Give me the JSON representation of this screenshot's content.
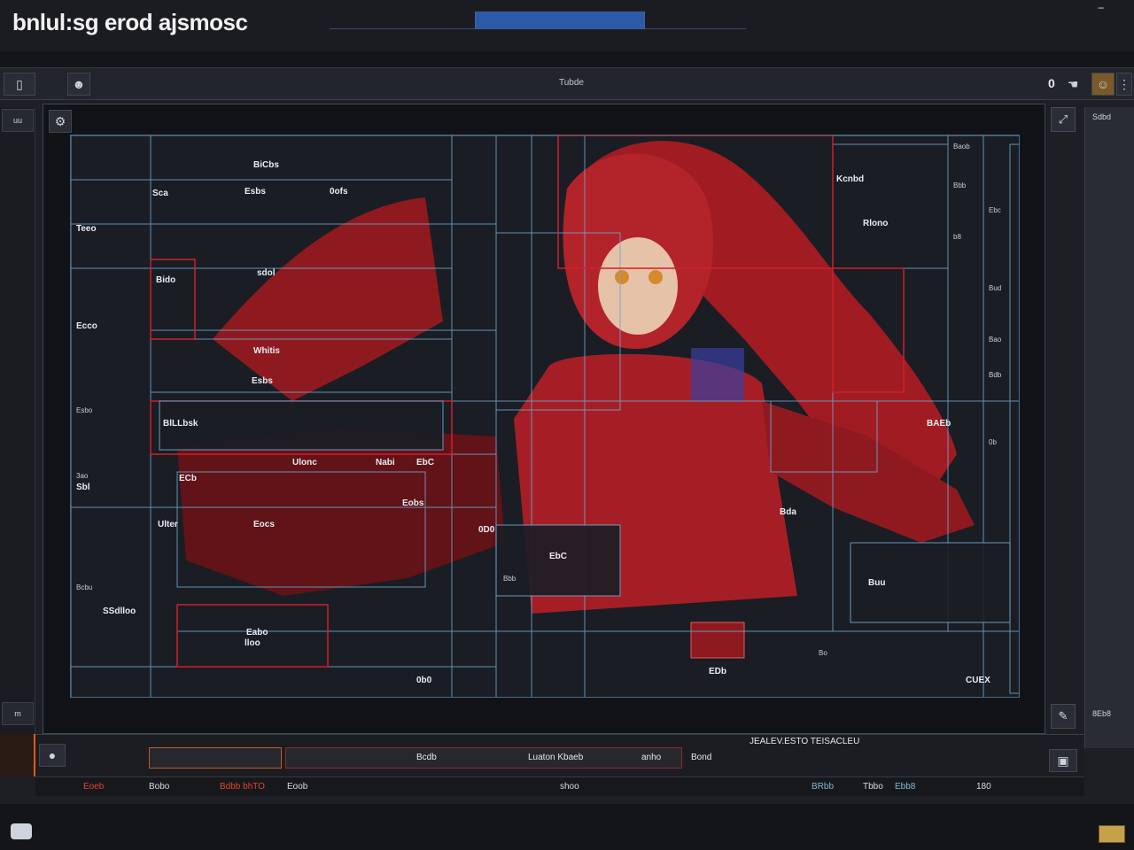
{
  "app": {
    "title": "bnlul:sg erod ajsmosc",
    "menu_glyph": "‾",
    "progress": 1.0
  },
  "toolbar": {
    "center_label": "Tubde",
    "right_count": "0"
  },
  "left_rail": {
    "tabs": [
      "uu",
      "m"
    ]
  },
  "right_panel": {
    "labels": [
      "Sdbd",
      "8Eb8"
    ]
  },
  "canvas": {
    "labels": [
      "BiCbs",
      "Sca",
      "Esbs",
      "0ofs",
      "Teeo",
      "Bido",
      "sdol",
      "Ecco",
      "Whitis",
      "Esbs",
      "BlLLbsk",
      "Ulonc",
      "Nabi",
      "EbC",
      "Eobs",
      "Eocs",
      "Ulter",
      "Sbl",
      "SSdlloo",
      "Eabo",
      "lloo",
      "ECb",
      "EbC",
      "Kcnbd",
      "Rlono",
      "Bda",
      "BAEb",
      "Buu",
      "0D0",
      "EDb",
      "CUEX",
      "0b0"
    ],
    "small_labels": [
      "Baob",
      "Bbb",
      "b8",
      "Ebc",
      "Bud",
      "Bao",
      "0b",
      "Bdb",
      "Esbo",
      "Bcbu",
      "3ao",
      "Bbb",
      "Bo"
    ]
  },
  "timeline": {
    "clips": [
      "Bcdb",
      "Luaton Kbaeb",
      "anho",
      "Bond"
    ],
    "header": "JEALEV.ESTO TEISACLEU"
  },
  "statusbar": {
    "items": [
      "Eoeb",
      "Bobo",
      "Bdbb bhTO",
      "Eoob",
      "shoo",
      "BRbb",
      "Tbbo",
      "Ebb8",
      "180"
    ]
  },
  "colors": {
    "accent": "#d0202a",
    "frame": "#4d6a86",
    "highlight": "#e05a1c"
  }
}
